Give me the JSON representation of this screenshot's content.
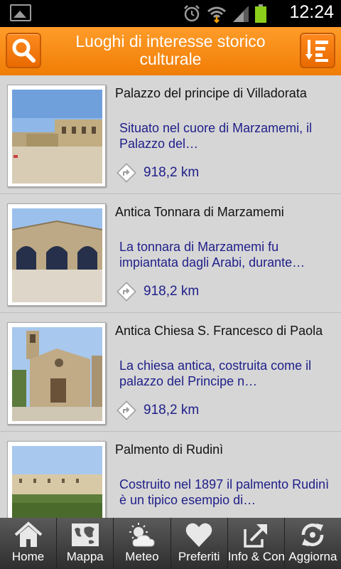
{
  "status_bar": {
    "time": "12:24"
  },
  "header": {
    "title": "Luoghi di interesse storico culturale",
    "search_icon": "search-icon",
    "sort_icon": "sort-list-icon"
  },
  "places": [
    {
      "name": "Palazzo del principe di Villadorata",
      "description": "Situato nel cuore di Marzamemi, il Palazzo del…",
      "distance": "918,2 km"
    },
    {
      "name": "Antica Tonnara di Marzamemi",
      "description": "La tonnara di Marzamemi fu impiantata dagli Arabi, durante…",
      "distance": "918,2 km"
    },
    {
      "name": "Antica Chiesa S. Francesco di Paola",
      "description": "La chiesa antica, costruita come il palazzo del Principe n…",
      "distance": "918,2 km"
    },
    {
      "name": "Palmento di Rudinì",
      "description": "Costruito nel 1897 il palmento Rudinì è un tipico esempio di…",
      "distance": ""
    }
  ],
  "tabs": [
    {
      "label": "Home",
      "icon": "home-icon"
    },
    {
      "label": "Mappa",
      "icon": "map-icon"
    },
    {
      "label": "Meteo",
      "icon": "weather-icon"
    },
    {
      "label": "Preferiti",
      "icon": "heart-icon"
    },
    {
      "label": "Info & Contatti",
      "icon": "share-icon"
    },
    {
      "label": "Aggiorna",
      "icon": "refresh-icon"
    }
  ],
  "colors": {
    "header": "#f58a12",
    "link_text": "#20208a",
    "list_background": "#d6d6d6",
    "tabbar": "#3c3c3c"
  }
}
